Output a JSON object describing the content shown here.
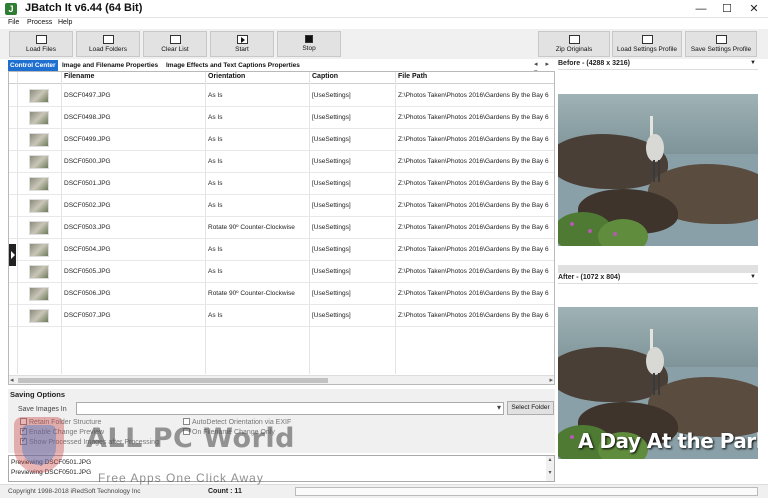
{
  "window": {
    "title": "JBatch It v6.44 (64 Bit)",
    "minimize": "—",
    "maximize": "☐",
    "close": "✕"
  },
  "menu": [
    "File",
    "Process",
    "Help"
  ],
  "toolbar": {
    "load_files": "Load Files",
    "load_folders": "Load Folders",
    "clear_list": "Clear List",
    "start": "Start",
    "stop": "Stop",
    "zip_originals": "Zip Originals",
    "load_settings_profile": "Load Settings Profile",
    "save_settings_profile": "Save Settings Profile"
  },
  "tabs": [
    "Control Center",
    "Image and Filename Properties",
    "Image Effects and Text Captions Properties"
  ],
  "tab_arrows": "◂ ▸ ▾",
  "grid": {
    "columns": [
      "Filename",
      "Orientation",
      "Caption",
      "File Path"
    ],
    "rows": [
      {
        "filename": "DSCF0497.JPG",
        "orientation": "As Is",
        "caption": "[UseSettings]",
        "path": "Z:\\Photos Taken\\Photos 2016\\Gardens By the Bay 6"
      },
      {
        "filename": "DSCF0498.JPG",
        "orientation": "As Is",
        "caption": "[UseSettings]",
        "path": "Z:\\Photos Taken\\Photos 2016\\Gardens By the Bay 6"
      },
      {
        "filename": "DSCF0499.JPG",
        "orientation": "As Is",
        "caption": "[UseSettings]",
        "path": "Z:\\Photos Taken\\Photos 2016\\Gardens By the Bay 6"
      },
      {
        "filename": "DSCF0500.JPG",
        "orientation": "As Is",
        "caption": "[UseSettings]",
        "path": "Z:\\Photos Taken\\Photos 2016\\Gardens By the Bay 6"
      },
      {
        "filename": "DSCF0501.JPG",
        "orientation": "As Is",
        "caption": "[UseSettings]",
        "path": "Z:\\Photos Taken\\Photos 2016\\Gardens By the Bay 6"
      },
      {
        "filename": "DSCF0502.JPG",
        "orientation": "As Is",
        "caption": "[UseSettings]",
        "path": "Z:\\Photos Taken\\Photos 2016\\Gardens By the Bay 6"
      },
      {
        "filename": "DSCF0503.JPG",
        "orientation": "Rotate 90º Counter-Clockwise",
        "caption": "[UseSettings]",
        "path": "Z:\\Photos Taken\\Photos 2016\\Gardens By the Bay 6"
      },
      {
        "filename": "DSCF0504.JPG",
        "orientation": "As Is",
        "caption": "[UseSettings]",
        "path": "Z:\\Photos Taken\\Photos 2016\\Gardens By the Bay 6"
      },
      {
        "filename": "DSCF0505.JPG",
        "orientation": "As Is",
        "caption": "[UseSettings]",
        "path": "Z:\\Photos Taken\\Photos 2016\\Gardens By the Bay 6"
      },
      {
        "filename": "DSCF0506.JPG",
        "orientation": "Rotate 90º Counter-Clockwise",
        "caption": "[UseSettings]",
        "path": "Z:\\Photos Taken\\Photos 2016\\Gardens By the Bay 6"
      },
      {
        "filename": "DSCF0507.JPG",
        "orientation": "As Is",
        "caption": "[UseSettings]",
        "path": "Z:\\Photos Taken\\Photos 2016\\Gardens By the Bay 6"
      }
    ]
  },
  "preview": {
    "before_label": "Before - (4288 x 3216)",
    "after_label": "After - (1072 x 804)",
    "after_caption": "A Day At the Park"
  },
  "saving": {
    "title": "Saving Options",
    "save_images_in_label": "Save Images In",
    "save_images_in_value": "",
    "select_folder": "Select Folder",
    "retain_folder_structure": "Retain Folder Structure",
    "enable_change_preview": "Enable Change Preview",
    "show_processed_images": "Show Processed Images after Processing",
    "autodetect_orientation": "AutoDetect Orientation via EXIF",
    "on_filename_change_only": "On Filename Change Only"
  },
  "log": [
    "Previewing DSCF0501.JPG",
    "Previewing DSCF0501.JPG"
  ],
  "status": {
    "copyright": "Copyright 1998-2018 iRedSoft Technology Inc",
    "count": "Count : 11"
  },
  "watermark": {
    "title": "ALL PC World",
    "subtitle": "Free Apps One Click Away"
  }
}
